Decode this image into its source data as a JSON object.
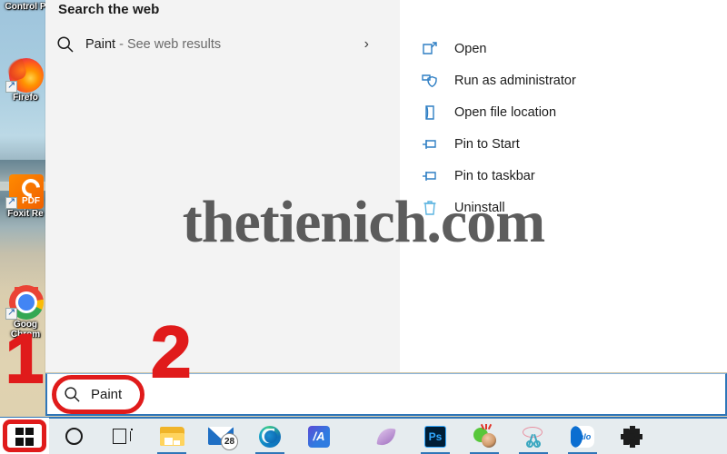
{
  "desktop": {
    "icons": [
      {
        "label": "Control P",
        "icon": "control-panel-icon"
      },
      {
        "label": "Firefo",
        "icon": "firefox-icon"
      },
      {
        "label": "Foxit Re",
        "icon": "foxit-reader-icon"
      },
      {
        "label": "Goog",
        "label2": "Chrom",
        "icon": "google-chrome-icon"
      }
    ]
  },
  "start_menu": {
    "left_pane": {
      "header": "Search the web",
      "web_result": {
        "term": "Paint",
        "suffix": " - See web results",
        "chevron": "›",
        "search_icon": "search-icon"
      }
    },
    "right_pane": {
      "actions": [
        {
          "label": "Open",
          "icon": "open-window-icon"
        },
        {
          "label": "Run as administrator",
          "icon": "shield-admin-icon"
        },
        {
          "label": "Open file location",
          "icon": "folder-open-icon"
        },
        {
          "label": "Pin to Start",
          "icon": "pin-icon"
        },
        {
          "label": "Pin to taskbar",
          "icon": "pin-icon"
        },
        {
          "label": "Uninstall",
          "icon": "trash-icon"
        }
      ]
    }
  },
  "watermark": {
    "text": "thetienich.com"
  },
  "search_bar": {
    "value": "Paint",
    "icon": "search-icon",
    "border_color": "#2f76b8"
  },
  "taskbar": {
    "items": [
      {
        "name": "start-button",
        "label": "Start",
        "icon": "windows-logo-icon"
      },
      {
        "name": "cortana-button",
        "label": "Cortana",
        "icon": "circle-icon"
      },
      {
        "name": "task-view-button",
        "label": "Task View",
        "icon": "task-view-icon"
      },
      {
        "name": "file-explorer-button",
        "label": "File Explorer",
        "icon": "folder-icon"
      },
      {
        "name": "mail-button",
        "label": "Mail",
        "icon": "mail-icon",
        "badge": "28"
      },
      {
        "name": "edge-button",
        "label": "Microsoft Edge",
        "icon": "edge-icon"
      },
      {
        "name": "anydesk-button",
        "label": "AnyDesk",
        "icon": "anydesk-icon",
        "glyph": "/A"
      },
      {
        "name": "feather-button",
        "label": "Feather app",
        "icon": "feather-icon"
      },
      {
        "name": "photoshop-button",
        "label": "Adobe Photoshop",
        "icon": "photoshop-icon",
        "glyph": "Ps"
      },
      {
        "name": "green-app-button",
        "label": "Green app",
        "icon": "green-app-icon"
      },
      {
        "name": "snipping-tool-button",
        "label": "Snipping Tool",
        "icon": "scissors-icon"
      },
      {
        "name": "zalo-button",
        "label": "Zalo",
        "icon": "zalo-icon",
        "glyph": "Zalo"
      },
      {
        "name": "settings-button",
        "label": "Settings",
        "icon": "gear-icon"
      }
    ]
  },
  "annotations": {
    "step1": "1",
    "step2": "2",
    "color": "#e01b1b"
  }
}
